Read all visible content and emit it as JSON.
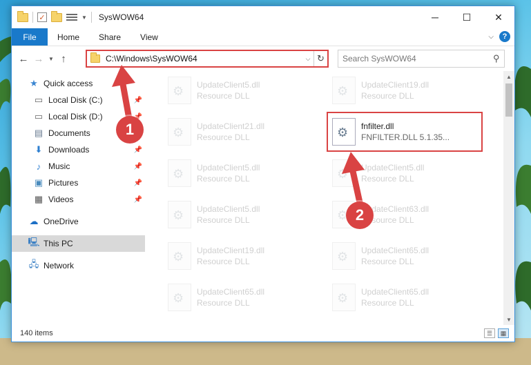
{
  "window": {
    "title": "SysWOW64",
    "minimize_label": "─",
    "maximize_label": "☐",
    "close_label": "✕"
  },
  "ribbon": {
    "tabs": [
      "File",
      "Home",
      "Share",
      "View"
    ]
  },
  "address": {
    "path": "C:\\Windows\\SysWOW64",
    "search_placeholder": "Search SysWOW64"
  },
  "nav": {
    "items": [
      {
        "label": "Quick access",
        "icon": "star-icon"
      },
      {
        "label": "Local Disk (C:)",
        "icon": "drive-icon",
        "pinned": true
      },
      {
        "label": "Local Disk (D:)",
        "icon": "drive-icon",
        "pinned": true
      },
      {
        "label": "Documents",
        "icon": "documents-icon",
        "pinned": true
      },
      {
        "label": "Downloads",
        "icon": "download-icon",
        "pinned": true
      },
      {
        "label": "Music",
        "icon": "music-icon",
        "pinned": true
      },
      {
        "label": "Pictures",
        "icon": "pictures-icon",
        "pinned": true
      },
      {
        "label": "Videos",
        "icon": "videos-icon",
        "pinned": true
      },
      {
        "label": "OneDrive",
        "icon": "cloud-icon"
      },
      {
        "label": "This PC",
        "icon": "computer-icon",
        "selected": true
      },
      {
        "label": "Network",
        "icon": "network-icon"
      }
    ]
  },
  "files": {
    "left": [
      {
        "name": "UpdateClient5.dll",
        "desc": "Resource DLL"
      },
      {
        "name": "UpdateClient21.dll",
        "desc": "Resource DLL"
      },
      {
        "name": "UpdateClient5.dll",
        "desc": "Resource DLL"
      },
      {
        "name": "UpdateClient5.dll",
        "desc": "Resource DLL"
      },
      {
        "name": "UpdateClient19.dll",
        "desc": "Resource DLL"
      },
      {
        "name": "UpdateClient65.dll",
        "desc": "Resource DLL"
      }
    ],
    "right": [
      {
        "name": "UpdateClient19.dll",
        "desc": "Resource DLL"
      },
      {
        "name": "fnfilter.dll",
        "desc": "FNFILTER.DLL 5.1.35...",
        "highlight": true
      },
      {
        "name": "UpdateClient5.dll",
        "desc": "Resource DLL"
      },
      {
        "name": "UpdateClient63.dll",
        "desc": "Resource DLL"
      },
      {
        "name": "UpdateClient65.dll",
        "desc": "Resource DLL"
      },
      {
        "name": "UpdateClient65.dll",
        "desc": "Resource DLL"
      }
    ]
  },
  "status": {
    "item_count": "140 items"
  },
  "annotations": {
    "step1": "1",
    "step2": "2",
    "color": "#d94343"
  }
}
